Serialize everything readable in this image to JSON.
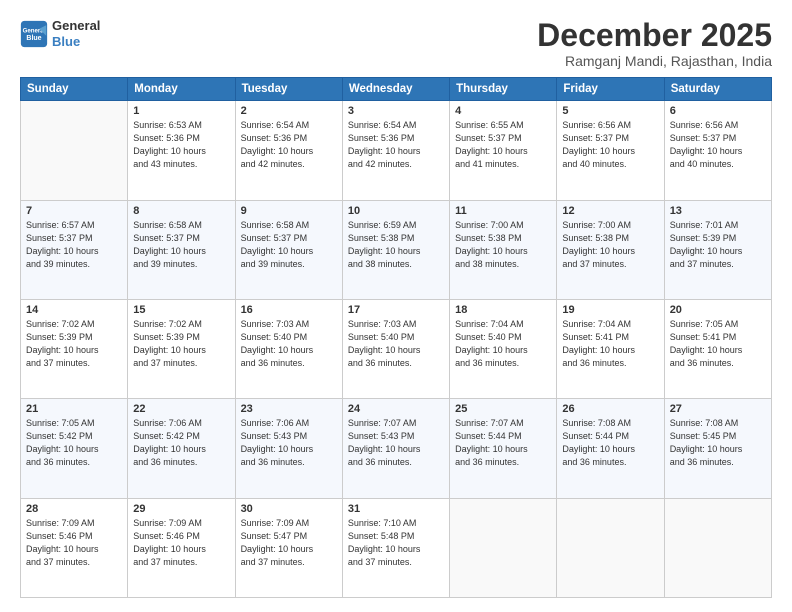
{
  "logo": {
    "line1": "General",
    "line2": "Blue"
  },
  "title": "December 2025",
  "subtitle": "Ramganj Mandi, Rajasthan, India",
  "headers": [
    "Sunday",
    "Monday",
    "Tuesday",
    "Wednesday",
    "Thursday",
    "Friday",
    "Saturday"
  ],
  "weeks": [
    [
      {
        "day": "",
        "info": ""
      },
      {
        "day": "1",
        "info": "Sunrise: 6:53 AM\nSunset: 5:36 PM\nDaylight: 10 hours\nand 43 minutes."
      },
      {
        "day": "2",
        "info": "Sunrise: 6:54 AM\nSunset: 5:36 PM\nDaylight: 10 hours\nand 42 minutes."
      },
      {
        "day": "3",
        "info": "Sunrise: 6:54 AM\nSunset: 5:36 PM\nDaylight: 10 hours\nand 42 minutes."
      },
      {
        "day": "4",
        "info": "Sunrise: 6:55 AM\nSunset: 5:37 PM\nDaylight: 10 hours\nand 41 minutes."
      },
      {
        "day": "5",
        "info": "Sunrise: 6:56 AM\nSunset: 5:37 PM\nDaylight: 10 hours\nand 40 minutes."
      },
      {
        "day": "6",
        "info": "Sunrise: 6:56 AM\nSunset: 5:37 PM\nDaylight: 10 hours\nand 40 minutes."
      }
    ],
    [
      {
        "day": "7",
        "info": "Sunrise: 6:57 AM\nSunset: 5:37 PM\nDaylight: 10 hours\nand 39 minutes."
      },
      {
        "day": "8",
        "info": "Sunrise: 6:58 AM\nSunset: 5:37 PM\nDaylight: 10 hours\nand 39 minutes."
      },
      {
        "day": "9",
        "info": "Sunrise: 6:58 AM\nSunset: 5:37 PM\nDaylight: 10 hours\nand 39 minutes."
      },
      {
        "day": "10",
        "info": "Sunrise: 6:59 AM\nSunset: 5:38 PM\nDaylight: 10 hours\nand 38 minutes."
      },
      {
        "day": "11",
        "info": "Sunrise: 7:00 AM\nSunset: 5:38 PM\nDaylight: 10 hours\nand 38 minutes."
      },
      {
        "day": "12",
        "info": "Sunrise: 7:00 AM\nSunset: 5:38 PM\nDaylight: 10 hours\nand 37 minutes."
      },
      {
        "day": "13",
        "info": "Sunrise: 7:01 AM\nSunset: 5:39 PM\nDaylight: 10 hours\nand 37 minutes."
      }
    ],
    [
      {
        "day": "14",
        "info": "Sunrise: 7:02 AM\nSunset: 5:39 PM\nDaylight: 10 hours\nand 37 minutes."
      },
      {
        "day": "15",
        "info": "Sunrise: 7:02 AM\nSunset: 5:39 PM\nDaylight: 10 hours\nand 37 minutes."
      },
      {
        "day": "16",
        "info": "Sunrise: 7:03 AM\nSunset: 5:40 PM\nDaylight: 10 hours\nand 36 minutes."
      },
      {
        "day": "17",
        "info": "Sunrise: 7:03 AM\nSunset: 5:40 PM\nDaylight: 10 hours\nand 36 minutes."
      },
      {
        "day": "18",
        "info": "Sunrise: 7:04 AM\nSunset: 5:40 PM\nDaylight: 10 hours\nand 36 minutes."
      },
      {
        "day": "19",
        "info": "Sunrise: 7:04 AM\nSunset: 5:41 PM\nDaylight: 10 hours\nand 36 minutes."
      },
      {
        "day": "20",
        "info": "Sunrise: 7:05 AM\nSunset: 5:41 PM\nDaylight: 10 hours\nand 36 minutes."
      }
    ],
    [
      {
        "day": "21",
        "info": "Sunrise: 7:05 AM\nSunset: 5:42 PM\nDaylight: 10 hours\nand 36 minutes."
      },
      {
        "day": "22",
        "info": "Sunrise: 7:06 AM\nSunset: 5:42 PM\nDaylight: 10 hours\nand 36 minutes."
      },
      {
        "day": "23",
        "info": "Sunrise: 7:06 AM\nSunset: 5:43 PM\nDaylight: 10 hours\nand 36 minutes."
      },
      {
        "day": "24",
        "info": "Sunrise: 7:07 AM\nSunset: 5:43 PM\nDaylight: 10 hours\nand 36 minutes."
      },
      {
        "day": "25",
        "info": "Sunrise: 7:07 AM\nSunset: 5:44 PM\nDaylight: 10 hours\nand 36 minutes."
      },
      {
        "day": "26",
        "info": "Sunrise: 7:08 AM\nSunset: 5:44 PM\nDaylight: 10 hours\nand 36 minutes."
      },
      {
        "day": "27",
        "info": "Sunrise: 7:08 AM\nSunset: 5:45 PM\nDaylight: 10 hours\nand 36 minutes."
      }
    ],
    [
      {
        "day": "28",
        "info": "Sunrise: 7:09 AM\nSunset: 5:46 PM\nDaylight: 10 hours\nand 37 minutes."
      },
      {
        "day": "29",
        "info": "Sunrise: 7:09 AM\nSunset: 5:46 PM\nDaylight: 10 hours\nand 37 minutes."
      },
      {
        "day": "30",
        "info": "Sunrise: 7:09 AM\nSunset: 5:47 PM\nDaylight: 10 hours\nand 37 minutes."
      },
      {
        "day": "31",
        "info": "Sunrise: 7:10 AM\nSunset: 5:48 PM\nDaylight: 10 hours\nand 37 minutes."
      },
      {
        "day": "",
        "info": ""
      },
      {
        "day": "",
        "info": ""
      },
      {
        "day": "",
        "info": ""
      }
    ]
  ]
}
